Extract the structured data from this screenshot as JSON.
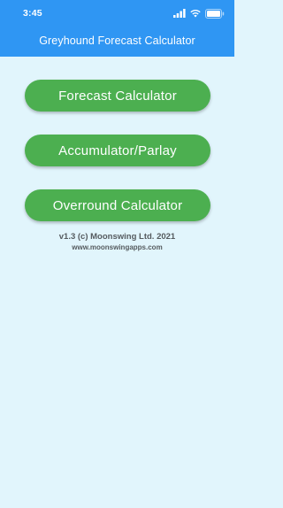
{
  "status_bar": {
    "time": "3:45",
    "icons": [
      "signal-icon",
      "wifi-icon",
      "battery-icon"
    ]
  },
  "app_bar": {
    "title": "Greyhound Forecast Calculator",
    "color": "#2f96f3"
  },
  "menu": {
    "buttons": [
      {
        "label": "Forecast Calculator"
      },
      {
        "label": "Accumulator/Parlay"
      },
      {
        "label": "Overround Calculator"
      }
    ],
    "button_color": "#4caf50"
  },
  "footer": {
    "version": "v1.3 (c) Moonswing Ltd. 2021",
    "website": "www.moonswingapps.com"
  },
  "background_color": "#e1f5fc"
}
